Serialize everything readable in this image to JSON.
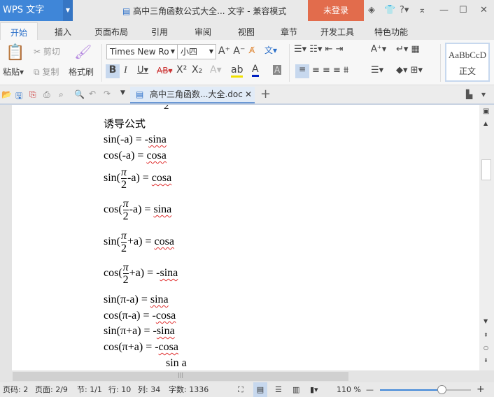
{
  "app": {
    "logo": "WPS 文字",
    "title": "高中三角函数公式大全... 文字 - 兼容模式",
    "login": "未登录"
  },
  "tabs": [
    "开始",
    "插入",
    "页面布局",
    "引用",
    "审阅",
    "视图",
    "章节",
    "开发工具",
    "特色功能"
  ],
  "ribbon": {
    "paste": "粘贴",
    "cut": "剪切",
    "copy": "复制",
    "format_painter": "格式刷",
    "font": "Times New Ro",
    "size": "小四",
    "style_preview": "AaBbCcD",
    "style_name": "正文"
  },
  "doc_tab": "高中三角函数...大全.doc",
  "document": {
    "heading": "诱导公式",
    "lines": [
      {
        "pre": "sin(-a) = -",
        "sq": "sina"
      },
      {
        "pre": "cos(-a) = ",
        "sq": "cosa"
      }
    ],
    "frac_lines": [
      {
        "fn": "sin(",
        "num": "π",
        "den": "2",
        "op": "-a) = ",
        "sq": "cosa"
      },
      {
        "fn": "cos(",
        "num": "π",
        "den": "2",
        "op": "-a) = ",
        "sq": "sina"
      },
      {
        "fn": "sin(",
        "num": "π",
        "den": "2",
        "op": "+a) = ",
        "sq": "cosa"
      },
      {
        "fn": "cos(",
        "num": "π",
        "den": "2",
        "op": "+a) = -",
        "sq": "sina"
      }
    ],
    "pi_lines": [
      {
        "pre": "sin(π-a) = ",
        "sq": "sina"
      },
      {
        "pre": "cos(π-a) = -",
        "sq": "cosa"
      },
      {
        "pre": "sin(π+a) = -",
        "sq": "sina"
      },
      {
        "pre": "cos(π+a) = -",
        "sq": "cosa"
      }
    ],
    "partial": "sin a"
  },
  "status": {
    "page_code": "页码: 2",
    "page": "页面: 2/9",
    "section": "节: 1/1",
    "row": "行: 10",
    "col": "列: 34",
    "words": "字数: 1336",
    "zoom": "110 %",
    "zoom_level": 0.68
  }
}
